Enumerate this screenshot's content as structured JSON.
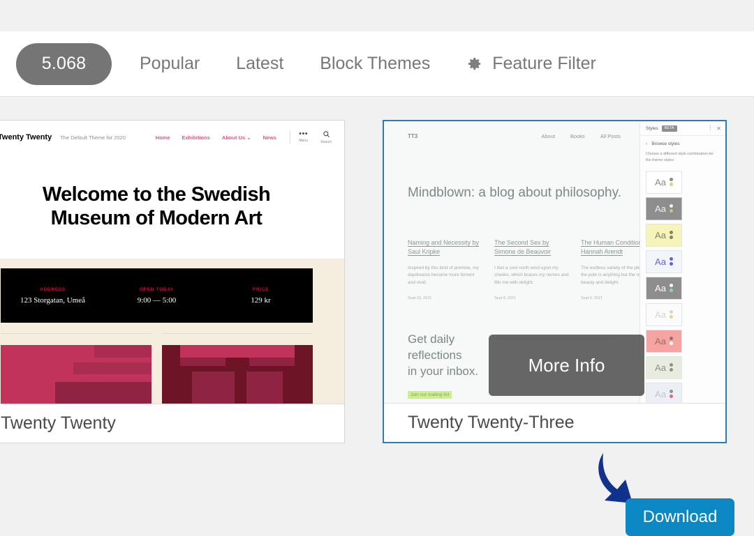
{
  "navbar": {
    "version": "5.068",
    "links": [
      {
        "label": "Popular",
        "icon": null
      },
      {
        "label": "Latest",
        "icon": null
      },
      {
        "label": "Block Themes",
        "icon": null
      },
      {
        "label": "Feature Filter",
        "icon": "gear-icon"
      }
    ]
  },
  "colors": {
    "accent_blue": "#0b87c4",
    "card_border_blue": "#2b7cb5",
    "arrow_navy": "#10328c",
    "pill_gray": "#757575",
    "cream": "#f5eedf",
    "pink": "#e8557f",
    "red_label": "#e0003c"
  },
  "themes": [
    {
      "name": "Twenty Twenty",
      "selected": false,
      "preview": {
        "logo": "Twenty Twenty",
        "tagline": "The Default Theme for 2020",
        "nav": [
          "Home",
          "Exhibitions",
          "About Us ⌄",
          "News"
        ],
        "menu_label": "Menu",
        "menu_glyph": "•••",
        "search_label": "Search",
        "hero_line1": "Welcome to the Swedish",
        "hero_line2": "Museum of Modern Art",
        "info": [
          {
            "label": "ADDRESS",
            "value": "123 Storgatan, Umeå"
          },
          {
            "label": "OPEN TODAY",
            "value": "9:00 — 5:00"
          },
          {
            "label": "PRICE",
            "value": "129 kr"
          }
        ]
      }
    },
    {
      "name": "Twenty Twenty-Three",
      "selected": true,
      "preview": {
        "logo": "TT3",
        "nav": [
          "About",
          "Books",
          "All Posts"
        ],
        "title": "Mindblown: a blog about philosophy.",
        "posts": [
          {
            "title": "Naming and Necessity by Saul Kripke",
            "body": "Inspired by this kind of premise, my daydreams become more fervent and vivid.",
            "date": "Sept 10, 2021"
          },
          {
            "title": "The Second Sex by Simone de Beauvoir",
            "body": "I feel a cool north wind upon my cheeks, which braces my nerves and fills me with delight.",
            "date": "Sept 8, 2021"
          },
          {
            "title": "The Human Condition by Hannah Arendt",
            "body": "The endless variety of the pleasures the pole is anything but the region of beauty and delight.",
            "date": "Sept 6, 2021"
          }
        ],
        "cta_line1": "Get daily",
        "cta_line2": "reflections",
        "cta_line3": "in your inbox.",
        "mailing_label": "Join our mailing list",
        "panel": {
          "title": "Styles",
          "badge": "BETA",
          "kebab_glyph": "⋮",
          "close_glyph": "✕",
          "back_glyph": "‹",
          "back_label": "Browse styles",
          "description": "Choose a different style combination for the theme styles",
          "swatches": [
            {
              "bg": "#ffffff",
              "text": "#8a8a8a",
              "dot_top": "#8a8a8a",
              "dot_bottom": "#b9e27a",
              "selected": false
            },
            {
              "bg": "#8d8d8d",
              "text": "#f0f0f0",
              "dot_top": "#f0f0f0",
              "dot_bottom": "#c9c08c",
              "selected": true
            },
            {
              "bg": "#f6f4b9",
              "text": "#83836a",
              "dot_top": "#83836a",
              "dot_bottom": "#83836a",
              "selected": false
            },
            {
              "bg": "#f2f5fa",
              "text": "#6b5de0",
              "dot_top": "#6b5de0",
              "dot_bottom": "#6b5de0",
              "selected": false
            },
            {
              "bg": "#8d8d8d",
              "text": "#ffffff",
              "dot_top": "#ffffff",
              "dot_bottom": "#98d3a6",
              "selected": false
            },
            {
              "bg": "#fbfbfb",
              "text": "#d6d6d6",
              "dot_top": "#d6d6d6",
              "dot_bottom": "#f0cf95",
              "selected": false
            },
            {
              "bg": "#f5a3a3",
              "text": "#9c6a6a",
              "dot_top": "#9c6a6a",
              "dot_bottom": "#ffffff",
              "selected": false
            },
            {
              "bg": "#e8ebe0",
              "text": "#8d9287",
              "dot_top": "#8d9287",
              "dot_bottom": "#8d9287",
              "selected": false
            },
            {
              "bg": "#eceff5",
              "text": "#c2c6cf",
              "dot_top": "#8f93a0",
              "dot_bottom": "#e0697d",
              "selected": false
            },
            {
              "bg": "#f6f2e3",
              "text": "#8d9287",
              "dot_top": "#8d9287",
              "dot_bottom": "#8d9287",
              "selected": false
            },
            {
              "bg": "#8b7f93",
              "text": "#e8e2ee",
              "dot_top": "#ffffff",
              "dot_bottom": "#f08a6b",
              "selected": false
            }
          ]
        }
      }
    }
  ],
  "overlays": {
    "more_info_label": "More Info",
    "download_label": "Download"
  }
}
